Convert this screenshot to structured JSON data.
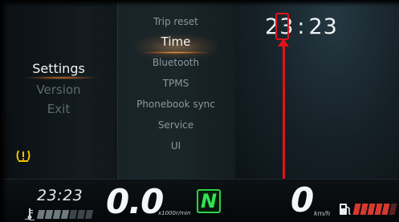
{
  "settings_menu": {
    "items": [
      {
        "label": "Settings",
        "active": true
      },
      {
        "label": "Version",
        "active": false
      },
      {
        "label": "Exit",
        "active": false
      }
    ]
  },
  "submenu": {
    "items": [
      {
        "label": "Trip reset",
        "active": false
      },
      {
        "label": "Time",
        "active": true
      },
      {
        "label": "Bluetooth",
        "active": false
      },
      {
        "label": "TPMS",
        "active": false
      },
      {
        "label": "Phonebook sync",
        "active": false
      },
      {
        "label": "Service",
        "active": false
      },
      {
        "label": "UI",
        "active": false
      }
    ]
  },
  "clock": {
    "hour_tens": "2",
    "hour_ones": "3",
    "separator": ":",
    "minutes": "23"
  },
  "annotation": {
    "highlight_color": "#e0121b",
    "highlighted_digit": "3"
  },
  "status_bar": {
    "time": "23:23",
    "rpm": "0.0",
    "rpm_unit": "x1000r/min",
    "gear": "N",
    "speed": "0",
    "speed_unit": "km/h",
    "temp_level": 0.4,
    "fuel_level": 0.75
  },
  "icons": {
    "tpms_warning": "tpms-warning-icon",
    "temperature": "thermometer-icon",
    "fuel": "fuel-pump-icon"
  },
  "colors": {
    "accent_glow": "#ff9a3c",
    "gear_green": "#2fe352",
    "fuel_red": "#d7392f",
    "warning_yellow": "#f2c200"
  }
}
